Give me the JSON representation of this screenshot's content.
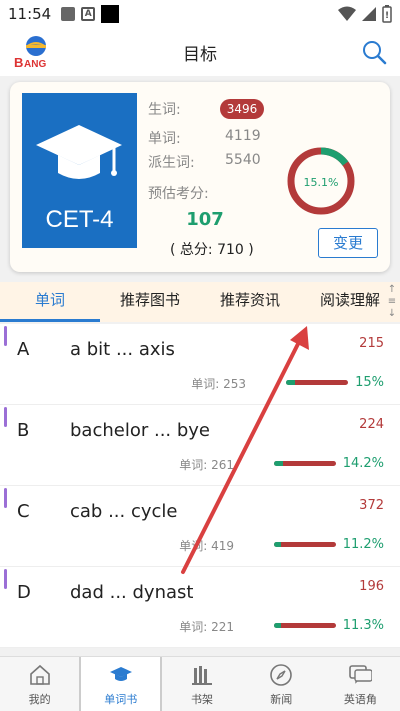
{
  "status": {
    "time": "11:54"
  },
  "appbar": {
    "title": "目标",
    "logo_text": "BANG"
  },
  "card": {
    "tile_label": "CET-4",
    "stats": {
      "new_label": "生词:",
      "new_value": "3496",
      "word_label": "单词:",
      "word_value": "4119",
      "derived_label": "派生词:",
      "derived_value": "5540"
    },
    "score_label": "预估考分:",
    "score": "107",
    "total": "( 总分: 710 )",
    "ring_percent": 15.1,
    "ring_text": "15.1%",
    "change_button": "变更"
  },
  "tabs": [
    "单词",
    "推荐图书",
    "推荐资讯",
    "阅读理解"
  ],
  "tab_scroll": {
    "up": "↑",
    "menu": "≡",
    "down": "↓"
  },
  "rows": [
    {
      "letter": "A",
      "range": "a bit ... axis",
      "count": "215",
      "words": "单词: 253",
      "percent": 15,
      "pct_text": "15%"
    },
    {
      "letter": "B",
      "range": "bachelor ... bye",
      "count": "224",
      "words": "单词: 261",
      "percent": 14.2,
      "pct_text": "14.2%"
    },
    {
      "letter": "C",
      "range": "cab ... cycle",
      "count": "372",
      "words": "单词: 419",
      "percent": 11.2,
      "pct_text": "11.2%"
    },
    {
      "letter": "D",
      "range": "dad ... dynast",
      "count": "196",
      "words": "单词: 221",
      "percent": 11.3,
      "pct_text": "11.3%"
    }
  ],
  "bottom_nav": [
    {
      "label": "我的",
      "icon": "home-icon"
    },
    {
      "label": "单词书",
      "icon": "graduation-cap-icon"
    },
    {
      "label": "书架",
      "icon": "bookshelf-icon"
    },
    {
      "label": "新闻",
      "icon": "compass-icon"
    },
    {
      "label": "英语角",
      "icon": "chat-icon"
    }
  ],
  "colors": {
    "accent": "#2a7bd0",
    "red": "#b33a3a",
    "green": "#1e9e6f",
    "tile": "#1a6fc2",
    "annotation_arrow": "#d94040"
  }
}
